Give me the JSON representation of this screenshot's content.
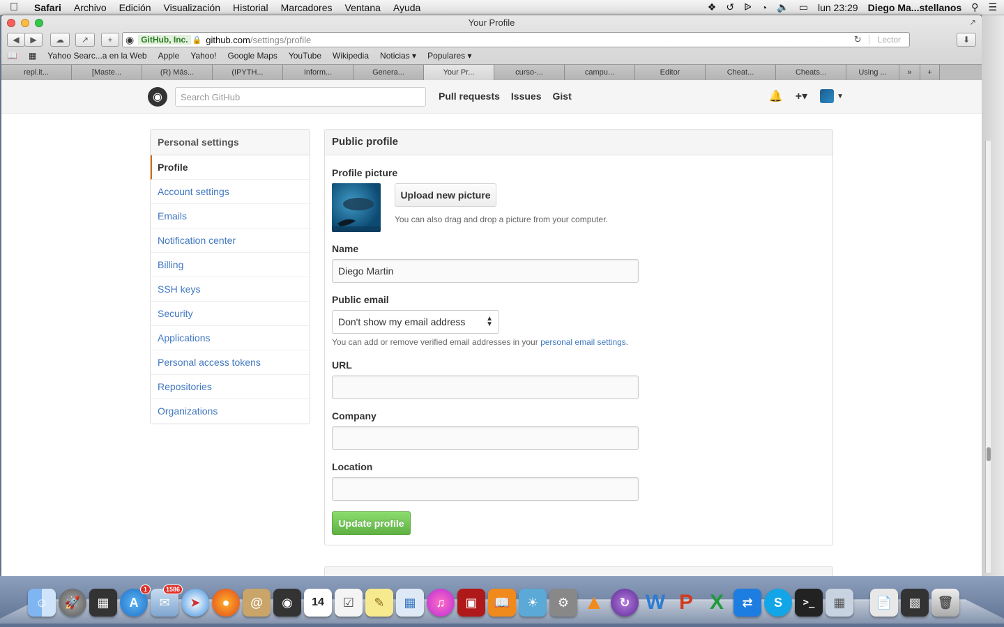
{
  "menubar": {
    "app": "Safari",
    "items": [
      "Archivo",
      "Edición",
      "Visualización",
      "Historial",
      "Marcadores",
      "Ventana",
      "Ayuda"
    ],
    "clock": "lun 23:29",
    "user": "Diego Ma...stellanos"
  },
  "window": {
    "title": "Your Profile",
    "url_ev": "GitHub, Inc.",
    "url_host": "github.com",
    "url_path": "/settings/profile",
    "reader_label": "Lector"
  },
  "bookmarks": [
    "Yahoo Searc...a en la Web",
    "Apple",
    "Yahoo!",
    "Google Maps",
    "YouTube",
    "Wikipedia",
    "Noticias ▾",
    "Populares ▾"
  ],
  "tabs": [
    "repl.it...",
    "[Maste...",
    "(R) Más...",
    "(IPYTH...",
    "Inform...",
    "Genera...",
    "Your Pr...",
    "curso-...",
    "campu...",
    "Editor",
    "Cheat...",
    "Cheats...",
    "Using ..."
  ],
  "active_tab": 6,
  "github": {
    "search_placeholder": "Search GitHub",
    "nav": [
      "Pull requests",
      "Issues",
      "Gist"
    ],
    "plus_label": "+▾"
  },
  "sidebar": {
    "heading": "Personal settings",
    "items": [
      {
        "label": "Profile",
        "selected": true
      },
      {
        "label": "Account settings"
      },
      {
        "label": "Emails"
      },
      {
        "label": "Notification center"
      },
      {
        "label": "Billing"
      },
      {
        "label": "SSH keys"
      },
      {
        "label": "Security"
      },
      {
        "label": "Applications"
      },
      {
        "label": "Personal access tokens"
      },
      {
        "label": "Repositories"
      },
      {
        "label": "Organizations"
      }
    ]
  },
  "profile": {
    "heading": "Public profile",
    "picture_label": "Profile picture",
    "upload_label": "Upload new picture",
    "upload_note": "You can also drag and drop a picture from your computer.",
    "name_label": "Name",
    "name_value": "Diego Martin",
    "email_label": "Public email",
    "email_selected": "Don't show my email address",
    "email_note_prefix": "You can add or remove verified email addresses in your ",
    "email_note_link": "personal email settings",
    "email_note_suffix": ".",
    "url_label": "URL",
    "url_value": "",
    "company_label": "Company",
    "company_value": "",
    "location_label": "Location",
    "location_value": "",
    "update_label": "Update profile"
  },
  "dock": {
    "badges": {
      "appstore": "1",
      "mail": "1586"
    },
    "calendar_day": "14"
  },
  "colors": {
    "link": "#4078c0",
    "selected_accent": "#d26911",
    "update_button": "#60b044"
  }
}
